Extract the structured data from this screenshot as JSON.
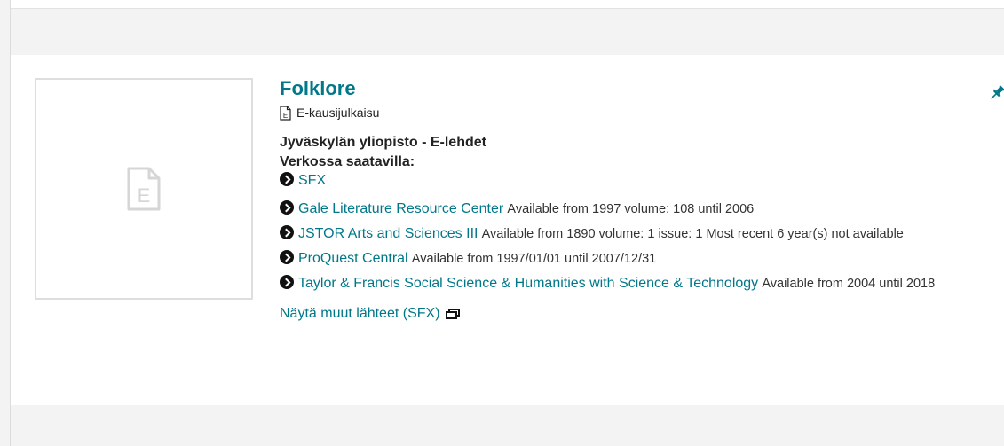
{
  "record": {
    "title": "Folklore",
    "format_label": "E-kausijulkaisu",
    "holder": "Jyväskylän yliopisto - E-lehdet",
    "online_heading": "Verkossa saatavilla:",
    "sfx_link": "SFX",
    "sources": [
      {
        "name": "Gale Literature Resource Center",
        "note": "Available from 1997 volume: 108 until 2006"
      },
      {
        "name": "JSTOR Arts and Sciences III",
        "note": "Available from 1890 volume: 1 issue: 1 Most recent 6 year(s) not available"
      },
      {
        "name": "ProQuest Central",
        "note": "Available from 1997/01/01 until 2007/12/31"
      },
      {
        "name": "Taylor & Francis Social Science & Humanities with Science & Technology",
        "note": "Available from 2004 until 2018"
      }
    ],
    "more_sources": "Näytä muut lähteet (SFX)"
  },
  "icons": {
    "thumbnail": "document-icon",
    "format": "document-icon",
    "pin": "pin-icon",
    "external": "external-window-icon"
  },
  "colors": {
    "link": "#00788a",
    "background": "#f3f3f3"
  }
}
